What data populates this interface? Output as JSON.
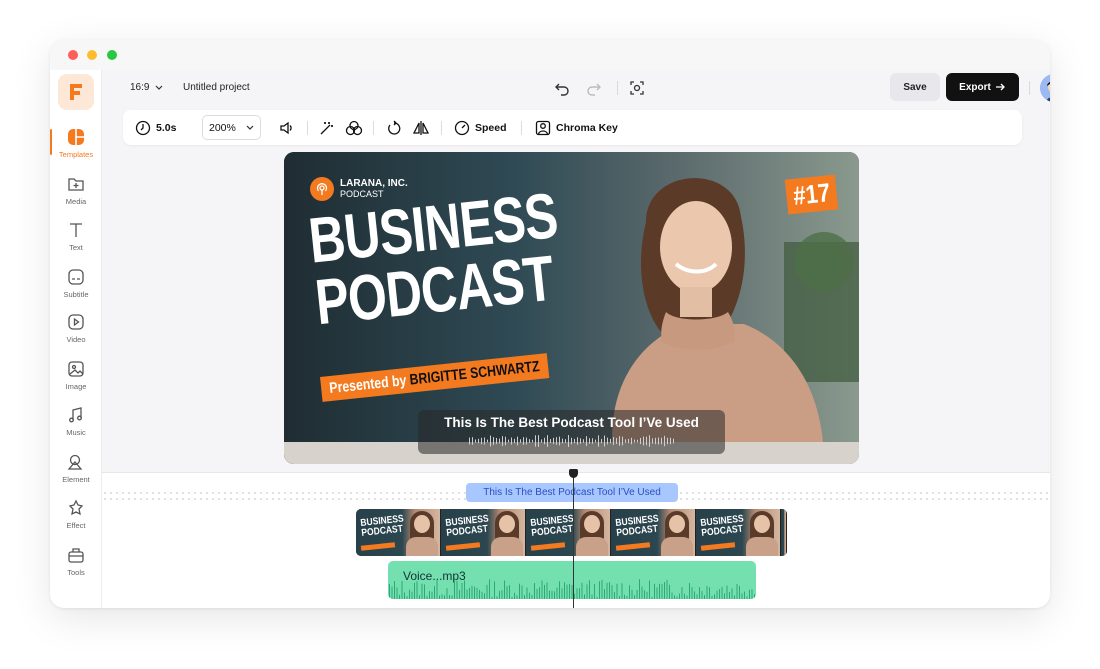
{
  "header": {
    "aspect_ratio": "16:9",
    "project_name": "Untitled project",
    "save_label": "Save",
    "export_label": "Export"
  },
  "sidebar": {
    "items": [
      {
        "label": "Templates",
        "icon": "templates-icon",
        "active": true
      },
      {
        "label": "Media",
        "icon": "media-icon"
      },
      {
        "label": "Text",
        "icon": "text-icon"
      },
      {
        "label": "Subtitle",
        "icon": "subtitle-icon"
      },
      {
        "label": "Video",
        "icon": "video-icon"
      },
      {
        "label": "Image",
        "icon": "image-icon"
      },
      {
        "label": "Music",
        "icon": "music-icon"
      },
      {
        "label": "Element",
        "icon": "element-icon"
      },
      {
        "label": "Effect",
        "icon": "effect-icon"
      },
      {
        "label": "Tools",
        "icon": "tools-icon"
      }
    ]
  },
  "toolbar": {
    "duration": "5.0s",
    "zoom": "200%",
    "speed_label": "Speed",
    "chroma_label": "Chroma Key"
  },
  "preview": {
    "brand_name": "LARANA, INC.",
    "brand_sub": "PODCAST",
    "headline_line1": "BUSINESS",
    "headline_line2": "PODCAST",
    "presented_prefix": "Presented by",
    "presenter": "BRIGITTE SCHWARTZ",
    "episode": "#17",
    "caption": "This Is The Best Podcast Tool I’Ve Used"
  },
  "timeline": {
    "subtitle_clip": "This Is The Best Podcast Tool I’Ve Used",
    "thumb_text_1": "BUSINESS",
    "thumb_text_2": "PODCAST",
    "audio_clip": "Voice...mp3"
  },
  "colors": {
    "accent": "#f47a20",
    "audio_track": "#74e0b0",
    "subtitle_clip": "#a9c7ff",
    "export_bg": "#111111"
  }
}
